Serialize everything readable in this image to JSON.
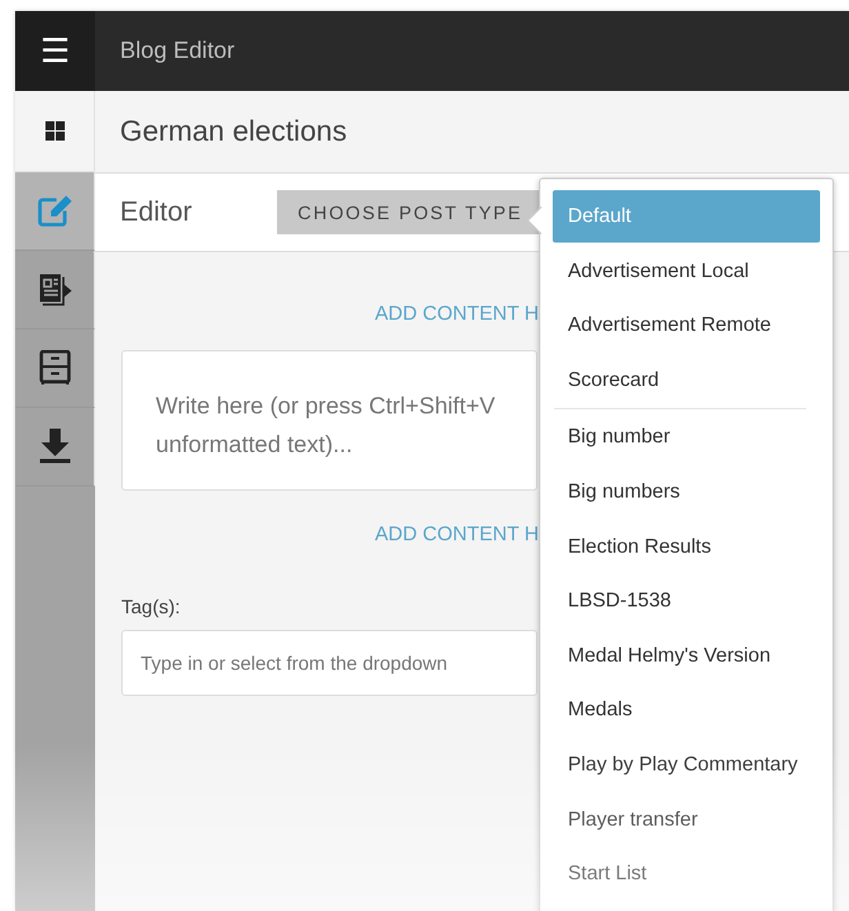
{
  "app_bar": {
    "menu_icon": "☰",
    "title": "Blog Editor"
  },
  "rail": [
    {
      "selected": true
    },
    {
      "selected": false
    },
    {
      "selected": false
    },
    {
      "selected": false
    }
  ],
  "post_title": "German elections",
  "editor": {
    "title": "Editor",
    "post_type_button": "CHOOSE POST TYPE",
    "add_content_links": [
      "ADD CONTENT H",
      "ADD CONTENT H"
    ],
    "body_placeholder_lines": [
      "Write here (or press Ctrl+Shift+V",
      "unformatted text)..."
    ],
    "tags_label": "Tag(s):",
    "tags_placeholder": "Type in or select from the dropdown"
  },
  "post_type_menu": [
    {
      "kind": "option",
      "label": "Default",
      "selected": true
    },
    {
      "kind": "option",
      "label": "Advertisement Local",
      "selected": false
    },
    {
      "kind": "option",
      "label": "Advertisement Remote",
      "selected": false
    },
    {
      "kind": "option",
      "label": "Scorecard",
      "selected": false
    },
    {
      "kind": "divider"
    },
    {
      "kind": "option",
      "label": "Big number",
      "selected": false
    },
    {
      "kind": "option",
      "label": "Big numbers",
      "selected": false
    },
    {
      "kind": "option",
      "label": "Election Results",
      "selected": false
    },
    {
      "kind": "option",
      "label": "LBSD-1538",
      "selected": false
    },
    {
      "kind": "option",
      "label": "Medal Helmy's Version",
      "selected": false
    },
    {
      "kind": "option",
      "label": "Medals",
      "selected": false
    },
    {
      "kind": "option",
      "label": "Play by Play Commentary",
      "selected": false
    },
    {
      "kind": "option",
      "label": "Player transfer",
      "selected": false
    },
    {
      "kind": "option",
      "label": "Start List",
      "selected": false
    }
  ]
}
